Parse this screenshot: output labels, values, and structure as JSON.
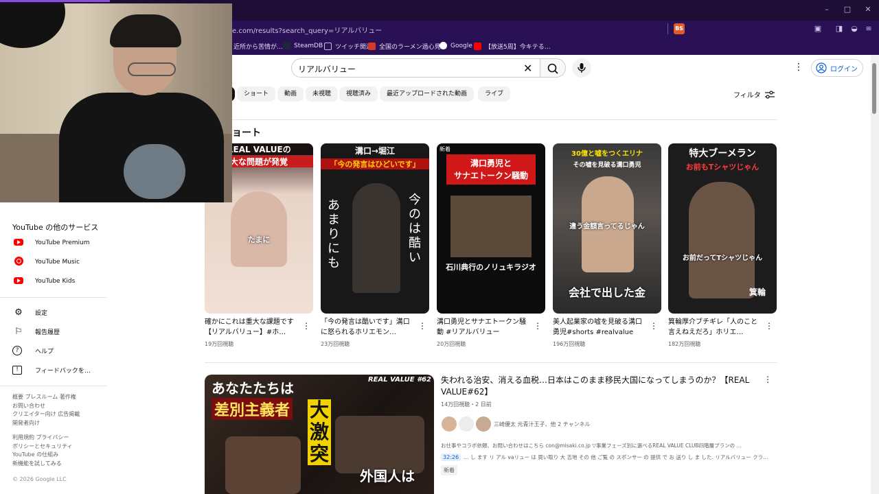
{
  "browser": {
    "url": "e.com/results?search_query=リアルバリュー",
    "brave_badge": "BS",
    "window_controls": {
      "minimize": "–",
      "maximize": "□",
      "close": "✕"
    },
    "bookmarks": [
      {
        "label": "近所から苦情が…",
        "color": "#e05a2b"
      },
      {
        "label": "SteamDB",
        "color": "#1b2838"
      },
      {
        "label": "ツイッチ関連",
        "color": "#9a7ad9"
      },
      {
        "label": "全国のラーメン過心見…",
        "color": "#d23a2a"
      },
      {
        "label": "Google",
        "color": "#4285f4"
      },
      {
        "label": "【放送5周】今キテる…",
        "color": "#f00"
      }
    ]
  },
  "header": {
    "search_query": "リアルバリュー",
    "more_icon": "⋮",
    "login_label": "ログイン"
  },
  "chips": [
    {
      "label": "ショート"
    },
    {
      "label": "動画"
    },
    {
      "label": "未視聴"
    },
    {
      "label": "視聴済み"
    },
    {
      "label": "最近アップロードされた動画"
    },
    {
      "label": "ライブ"
    }
  ],
  "filter_label": "フィルタ",
  "shorts_section_title": "ョート",
  "shorts": [
    {
      "title": "確かにこれは重大な課題です【リアルバリュー】#ホ…",
      "views": "19万回視聴",
      "caption_top": "REAL VALUEの",
      "caption_mid": "大な問題が発覚",
      "overlay": "たまに",
      "bg": "#e8d4c8",
      "accent": "#c91c1c"
    },
    {
      "title": "「今の発言は酷いです」溝口に怒られるホリエモン…",
      "views": "23万回視聴",
      "caption_top": "溝口→堀江",
      "caption_mid": "「今の発言はひどいです」",
      "overlay_left": "あまりにも",
      "overlay_right": "今のは酷い",
      "bg": "#181818",
      "accent": "#ffd400"
    },
    {
      "title": "溝口勇児とサナエトークン騒動 #リアルバリュー",
      "views": "20万回視聴",
      "new_tag": "新着",
      "caption_top": "溝口勇児と",
      "caption_mid": "サナエトークン騒動",
      "overlay": "石川典行のノリュキラジオ",
      "bg": "#0c0c0c",
      "accent": "#d01818"
    },
    {
      "title": "美人起業家の嘘を見破る溝口勇児#shorts #realvalue",
      "views": "196万回視聴",
      "caption_top": "30億と嘘をつくエリナ",
      "caption_mid": "その嘘を見破る溝口勇児",
      "overlay": "違う金額言ってるじゃん",
      "overlay_bottom": "会社で出した金",
      "bg": "#2a2a2a",
      "accent": "#ffe000"
    },
    {
      "title": "箕輪厚介ブチギレ「人のこと言えねえだろ」ホリエ…",
      "views": "182万回視聴",
      "caption_top": "特大ブーメラン",
      "caption_mid": "お前もTシャツじゃん",
      "overlay": "お前だってTシャツじゃん",
      "overlay_bottom": "箕輪",
      "bg": "#1c1c1c",
      "accent": "#ff3b3b"
    }
  ],
  "video": {
    "title": "失われる治安、消える血税…日本はこのまま移民大国になってしまうのか？【REAL VALUE#62】",
    "meta": "14万回視聴・2 日前",
    "channel": "三崎優太 元青汁王子、他 2 チャンネル",
    "description": "お仕事やコラボ依頼、お問い合わせはこちら con@misaki.co.jp ▽事業フェーズ別に選べるREAL VALUE CLUB四階層プランの …",
    "chapter_time": "32:26",
    "chapter_text": "… し ます リ アル vaリュー は 買い取り 大 吉地 その 他 ご覧 の スポンサー の 提供 で お 送り し ま した. リアルバリュー クラ…",
    "badge": "新着",
    "thumb_tag": "REAL VALUE #62",
    "thumb_text1": "あなたたちは",
    "thumb_text2": "差別主義者",
    "thumb_text3": "大激突",
    "thumb_text4": "外国人は"
  },
  "sidebar": {
    "section_title": "YouTube の他のサービス",
    "services": [
      {
        "label": "YouTube Premium"
      },
      {
        "label": "YouTube Music"
      },
      {
        "label": "YouTube Kids"
      }
    ],
    "items": [
      {
        "label": "設定",
        "icon": "⚙"
      },
      {
        "label": "報告履歴",
        "icon": "⚐"
      },
      {
        "label": "ヘルプ",
        "icon": "?"
      },
      {
        "label": "フィードバックを…",
        "icon": "!"
      }
    ],
    "footer1": [
      "概要 プレスルーム 著作権",
      "お問い合わせ",
      "クリエイター向け 広告掲載",
      "開発者向け"
    ],
    "footer2": [
      "利用規約 プライバシー",
      "ポリシーとセキュリティ",
      "YouTube の仕組み",
      "新機能を試してみる"
    ],
    "copyright": "© 2026 Google LLC"
  }
}
